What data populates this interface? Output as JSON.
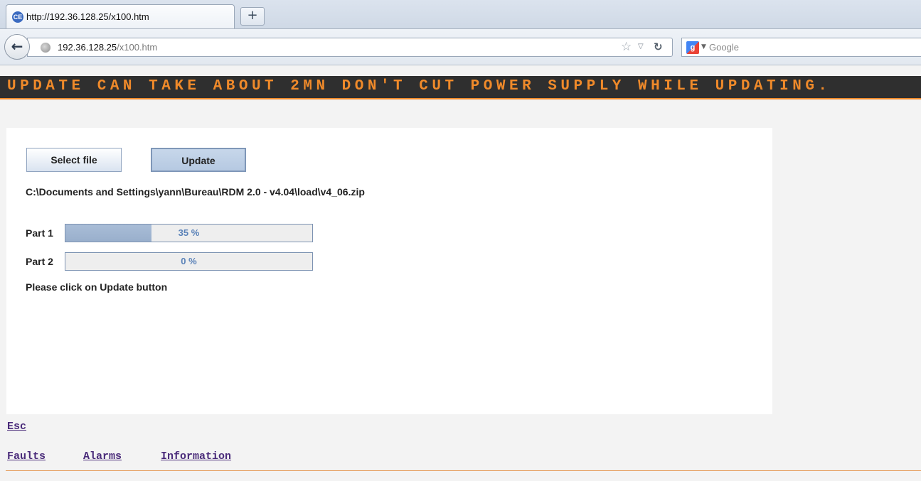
{
  "browser": {
    "tab_title": "http://192.36.128.25/x100.htm",
    "new_tab_label": "+",
    "url_host": "192.36.128.25",
    "url_path": "/x100.htm",
    "search_placeholder": "Google",
    "favicon_text": "CE"
  },
  "page": {
    "banner": "UPDATE CAN TAKE ABOUT 2MN DON'T CUT POWER SUPPLY WHILE UPDATING.",
    "select_file_label": "Select file",
    "update_label": "Update",
    "file_path": "C:\\Documents and Settings\\yann\\Bureau\\RDM 2.0 - v4.04\\load\\v4_06.zip",
    "parts": [
      {
        "label": "Part 1",
        "progress_text": "35 %",
        "progress": 35
      },
      {
        "label": "Part 2",
        "progress_text": "0 %",
        "progress": 0
      }
    ],
    "status": "Please click on Update button"
  },
  "footer": {
    "esc": "Esc",
    "links": [
      "Faults",
      "Alarms",
      "Information"
    ]
  },
  "colors": {
    "banner_bg": "#2f2f2f",
    "banner_text": "#f08a2a",
    "link": "#4a2b7a",
    "progress_fill": "#a9bdd7",
    "progress_text": "#5a82b8"
  }
}
